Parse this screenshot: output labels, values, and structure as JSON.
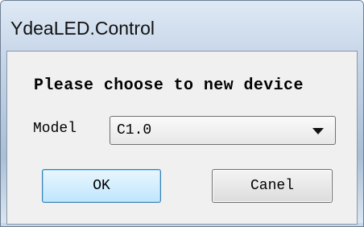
{
  "window": {
    "title": "YdeaLED.Control"
  },
  "dialog": {
    "heading": "Please choose to new device",
    "model_label": "Model",
    "model_value": "C1.0",
    "ok_label": "OK",
    "cancel_label": "Canel"
  }
}
